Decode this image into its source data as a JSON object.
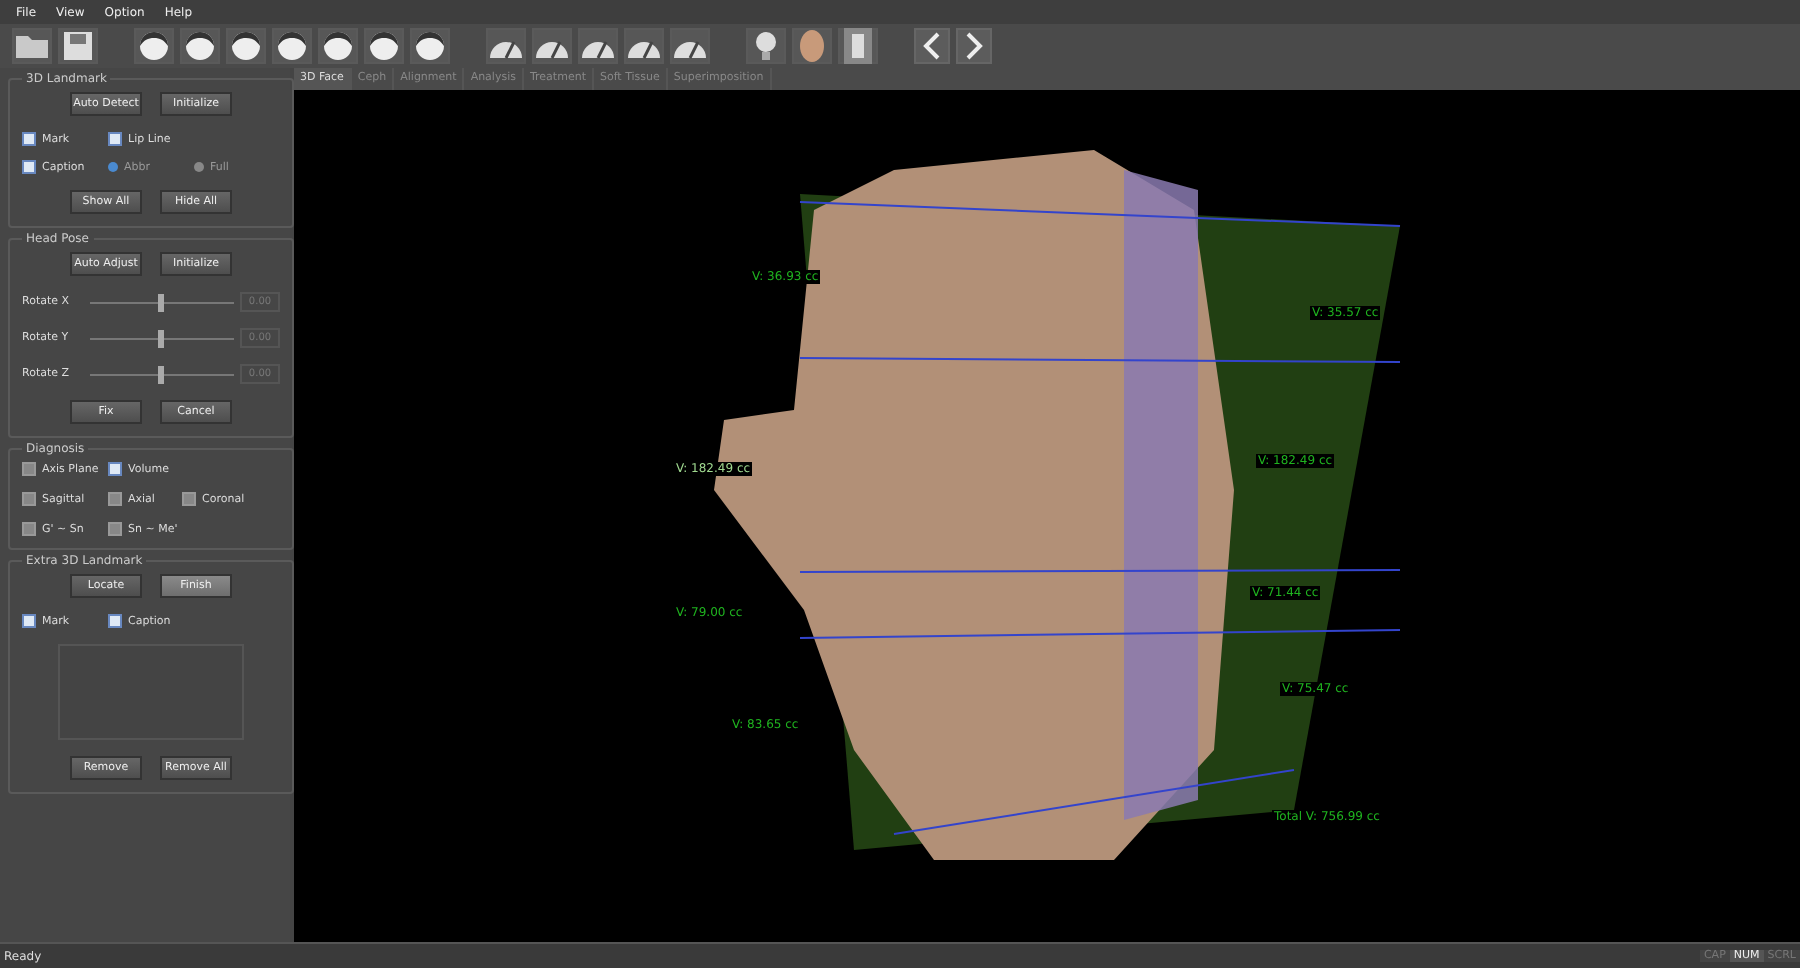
{
  "menu": [
    "File",
    "View",
    "Option",
    "Help"
  ],
  "tabs": [
    {
      "label": "3D Face",
      "selected": true
    },
    {
      "label": "Ceph",
      "selected": false
    },
    {
      "label": "Alignment",
      "selected": false
    },
    {
      "label": "Analysis",
      "selected": false
    },
    {
      "label": "Treatment",
      "selected": false
    },
    {
      "label": "Soft Tissue",
      "selected": false
    },
    {
      "label": "Superimposition",
      "selected": false
    }
  ],
  "landmark": {
    "title": "3D Landmark",
    "buttons": [
      "Auto Detect",
      "Initialize"
    ],
    "options": [
      {
        "kind": "checkbox",
        "label": "Mark",
        "checked": true
      },
      {
        "kind": "checkbox",
        "label": "Lip Line",
        "checked": true
      },
      {
        "kind": "checkbox",
        "label": "Caption",
        "checked": true
      },
      {
        "kind": "radio",
        "label": "Abbr",
        "selected": true
      },
      {
        "kind": "radio",
        "label": "Full",
        "selected": false
      }
    ],
    "buttons2": [
      "Show All",
      "Hide All"
    ]
  },
  "head_pose": {
    "title": "Head Pose",
    "buttons": [
      "Auto Adjust",
      "Initialize"
    ],
    "rotations": [
      {
        "label": "Rotate X",
        "level": 0.5,
        "reading": "0.00"
      },
      {
        "label": "Rotate Y",
        "level": 0.5,
        "reading": "0.00"
      },
      {
        "label": "Rotate Z",
        "level": 0.5,
        "reading": "0.00"
      }
    ],
    "buttons2": [
      "Fix",
      "Cancel"
    ]
  },
  "diagnosis": {
    "title": "Diagnosis",
    "options": [
      {
        "label": "Axis Plane",
        "checked": false
      },
      {
        "label": "Volume",
        "checked": true
      },
      {
        "label": "Sagittal",
        "checked": false
      },
      {
        "label": "Axial",
        "checked": false
      },
      {
        "label": "Coronal",
        "checked": false
      },
      {
        "label": "G' ~ Sn",
        "checked": false
      },
      {
        "label": "Sn ~ Me'",
        "checked": false
      }
    ]
  },
  "extra": {
    "title": "Extra 3D Landmark",
    "buttons": [
      {
        "label": "Locate",
        "selected": false
      },
      {
        "label": "Finish",
        "selected": true
      }
    ],
    "options": [
      {
        "label": "Mark",
        "checked": true
      },
      {
        "label": "Caption",
        "checked": true
      }
    ],
    "buttons2": [
      "Remove",
      "Remove All"
    ]
  },
  "volumes": [
    {
      "text": "V: 36.93 cc",
      "faded": false
    },
    {
      "text": "V: 35.57 cc",
      "faded": false
    },
    {
      "text": "V: 182.49 cc",
      "faded": true
    },
    {
      "text": "V: 182.49 cc",
      "faded": false
    },
    {
      "text": "V: 71.44 cc",
      "faded": false
    },
    {
      "text": "V: 79.00 cc",
      "faded": false
    },
    {
      "text": "V: 75.47 cc",
      "faded": false
    },
    {
      "text": "V: 83.65 cc",
      "faded": false
    },
    {
      "text": "Total V: 756.99 cc",
      "faded": false
    }
  ],
  "status_bar": {
    "text": "Ready",
    "indicators": [
      {
        "label": "CAP",
        "on": false
      },
      {
        "label": "NUM",
        "on": true
      },
      {
        "label": "SCRL",
        "on": false
      }
    ]
  }
}
